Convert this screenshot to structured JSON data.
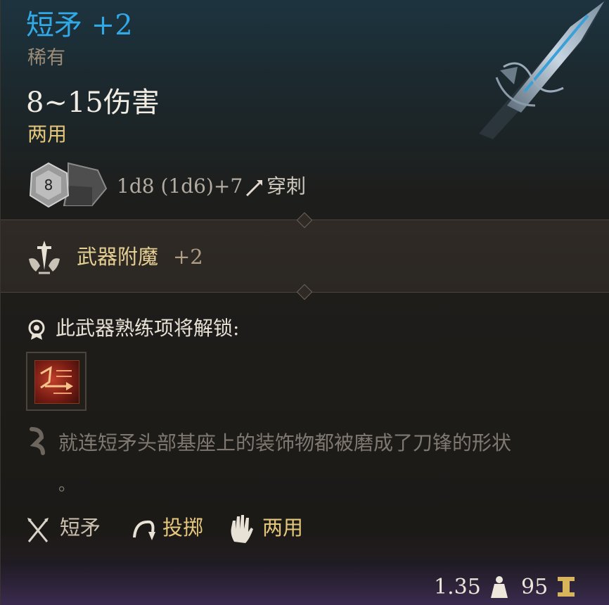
{
  "item": {
    "name": "短矛 +2",
    "rarity": "稀有",
    "damage_range": "8~15伤害",
    "handedness": "两用",
    "dice_face": "8",
    "damage_dice": "1d8 (1d6)+7",
    "damage_type": "穿刺"
  },
  "enchantment": {
    "label": "武器附魔",
    "bonus": "+2"
  },
  "proficiency": {
    "header": "此武器熟练项将解锁:"
  },
  "flavor": {
    "line1": "就连短矛头部基座上的装饰物都被磨成了刀锋的形状",
    "line2": "。"
  },
  "properties": [
    {
      "label": "短矛",
      "icon": "crossed-spears-icon"
    },
    {
      "label": "投掷",
      "icon": "throw-arc-icon"
    },
    {
      "label": "两用",
      "icon": "hand-icon"
    }
  ],
  "footer": {
    "weight": "1.35",
    "value": "95"
  },
  "colors": {
    "title": "#30a9e6",
    "gold_text": "#e4c77c",
    "rarity": "#9b8b77"
  }
}
